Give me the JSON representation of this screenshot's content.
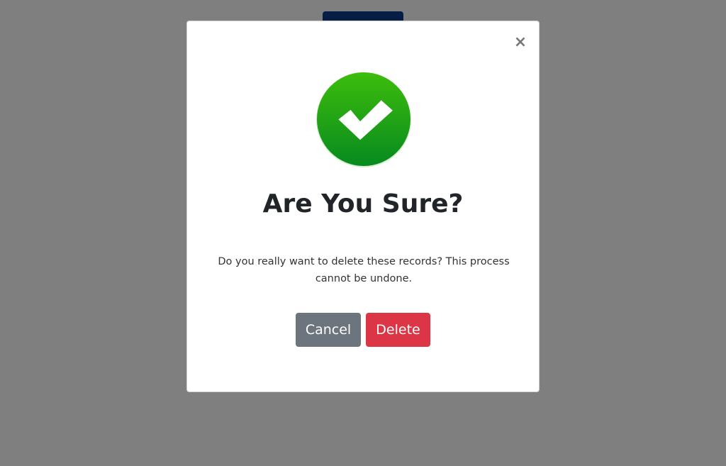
{
  "dialog": {
    "close_glyph": "×",
    "icon": "check-circle-icon",
    "title": "Are You Sure?",
    "body_text": "Do you really want to delete these records? This process cannot be undone.",
    "cancel_label": "Cancel",
    "delete_label": "Delete"
  },
  "colors": {
    "trigger_button": "#0d3a8c",
    "backdrop": "rgba(0,0,0,0.5)",
    "success_green": "#2eb00a",
    "cancel_button": "#6c757d",
    "delete_button": "#dc3545"
  }
}
